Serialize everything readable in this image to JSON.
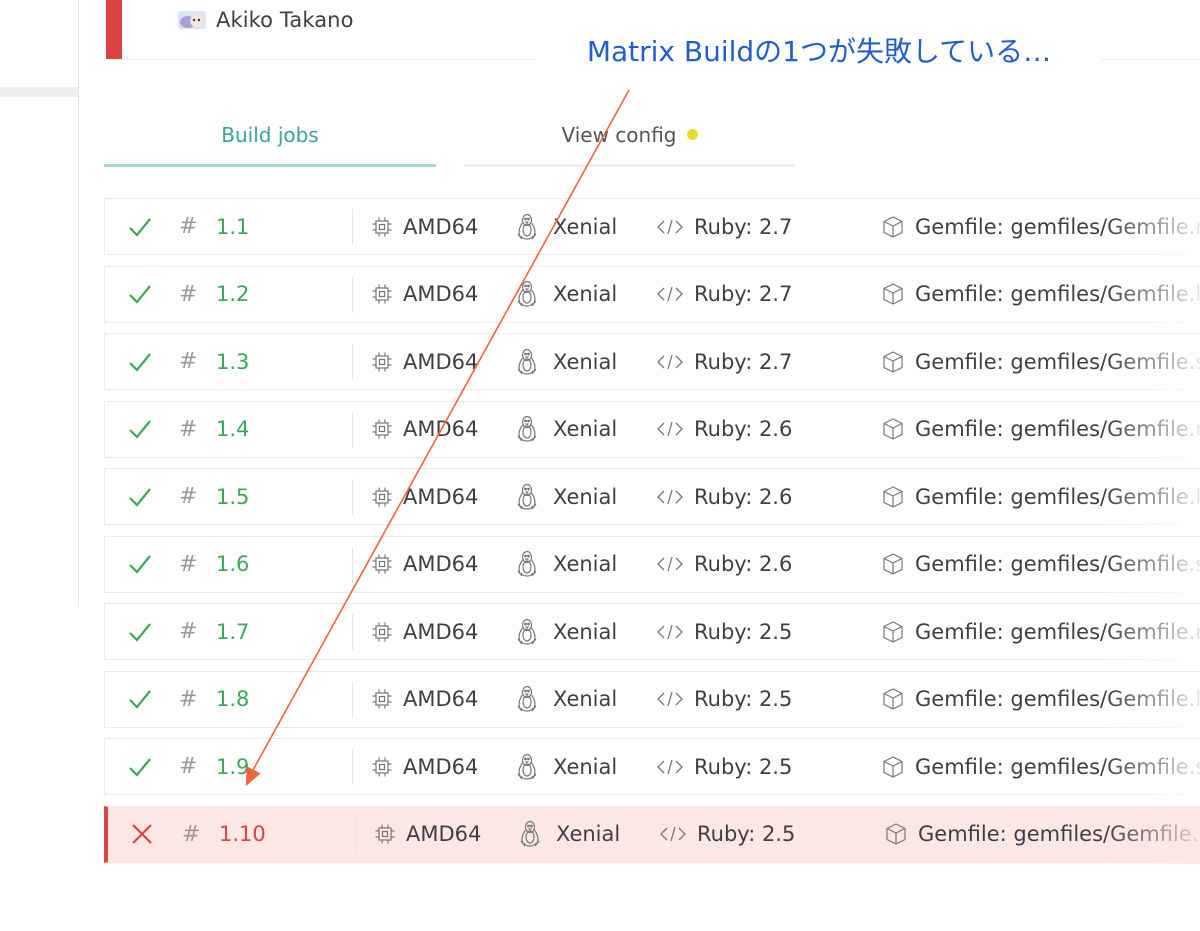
{
  "author": {
    "name": "Akiko Takano"
  },
  "tabs": [
    {
      "label": "Build jobs",
      "active": true
    },
    {
      "label": "View config",
      "has_dot": true
    }
  ],
  "colors": {
    "passed": "#39aa56",
    "failed": "#db4545",
    "tab_active": "#3aa1a5",
    "annotation": "#1f5fcf",
    "arrow": "#f0643b",
    "config_dot": "#e6dd2f"
  },
  "jobs": [
    {
      "status": "passed",
      "hash": "#",
      "number": "1.1",
      "arch": "AMD64",
      "os": "Xenial",
      "language": "Ruby: 2.7",
      "gemfile": "Gemfile: gemfiles/Gemfile.r"
    },
    {
      "status": "passed",
      "hash": "#",
      "number": "1.2",
      "arch": "AMD64",
      "os": "Xenial",
      "language": "Ruby: 2.7",
      "gemfile": "Gemfile: gemfiles/Gemfile.la"
    },
    {
      "status": "passed",
      "hash": "#",
      "number": "1.3",
      "arch": "AMD64",
      "os": "Xenial",
      "language": "Ruby: 2.7",
      "gemfile": "Gemfile: gemfiles/Gemfile.s"
    },
    {
      "status": "passed",
      "hash": "#",
      "number": "1.4",
      "arch": "AMD64",
      "os": "Xenial",
      "language": "Ruby: 2.6",
      "gemfile": "Gemfile: gemfiles/Gemfile.r"
    },
    {
      "status": "passed",
      "hash": "#",
      "number": "1.5",
      "arch": "AMD64",
      "os": "Xenial",
      "language": "Ruby: 2.6",
      "gemfile": "Gemfile: gemfiles/Gemfile.la"
    },
    {
      "status": "passed",
      "hash": "#",
      "number": "1.6",
      "arch": "AMD64",
      "os": "Xenial",
      "language": "Ruby: 2.6",
      "gemfile": "Gemfile: gemfiles/Gemfile.s"
    },
    {
      "status": "passed",
      "hash": "#",
      "number": "1.7",
      "arch": "AMD64",
      "os": "Xenial",
      "language": "Ruby: 2.5",
      "gemfile": "Gemfile: gemfiles/Gemfile.r"
    },
    {
      "status": "passed",
      "hash": "#",
      "number": "1.8",
      "arch": "AMD64",
      "os": "Xenial",
      "language": "Ruby: 2.5",
      "gemfile": "Gemfile: gemfiles/Gemfile.la"
    },
    {
      "status": "passed",
      "hash": "#",
      "number": "1.9",
      "arch": "AMD64",
      "os": "Xenial",
      "language": "Ruby: 2.5",
      "gemfile": "Gemfile: gemfiles/Gemfile.s"
    },
    {
      "status": "failed",
      "hash": "#",
      "number": "1.10",
      "arch": "AMD64",
      "os": "Xenial",
      "language": "Ruby: 2.5",
      "gemfile": "Gemfile: gemfiles/Gemfile.r"
    }
  ],
  "icons": {
    "passed": "checkmark-icon",
    "failed": "cross-icon",
    "arch": "cpu-icon",
    "os": "linux-penguin-icon",
    "language": "code-icon",
    "gemfile": "package-box-icon"
  },
  "annotation": {
    "text": "Matrix Buildの1つが失敗している…"
  }
}
